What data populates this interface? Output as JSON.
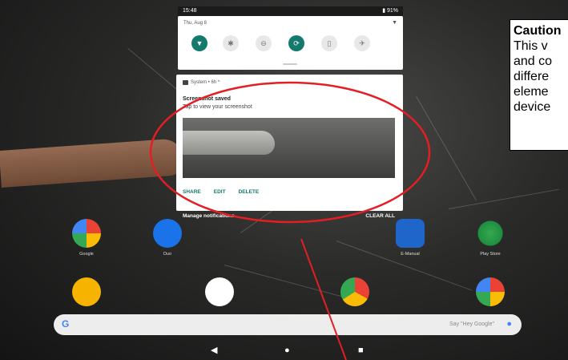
{
  "status_bar": {
    "time": "15:48",
    "battery": "91%"
  },
  "quick_settings": {
    "date": "Thu, Aug 8",
    "tiles": [
      {
        "name": "wifi-icon",
        "glyph": "▼",
        "on": true
      },
      {
        "name": "bluetooth-icon",
        "glyph": "✱",
        "on": false
      },
      {
        "name": "do-not-disturb-icon",
        "glyph": "⊖",
        "on": false
      },
      {
        "name": "auto-rotate-icon",
        "glyph": "⟳",
        "on": true
      },
      {
        "name": "flashlight-icon",
        "glyph": "▯",
        "on": false
      },
      {
        "name": "airplane-mode-icon",
        "glyph": "✈",
        "on": false
      }
    ]
  },
  "notification": {
    "app": "System • 6h ^",
    "title": "Screenshot saved",
    "subtitle": "Tap to view your screenshot",
    "actions": [
      "SHARE",
      "EDIT",
      "DELETE"
    ]
  },
  "shade_footer": {
    "manage": "Manage notifications",
    "clear_all": "CLEAR ALL"
  },
  "apps": [
    {
      "label": "Google"
    },
    {
      "label": "Duo"
    },
    {
      "label": "E-Manual"
    },
    {
      "label": "Play Store"
    }
  ],
  "search": {
    "logo": "G",
    "hint": "Say \"Hey Google\""
  },
  "nav": {
    "back": "◀",
    "home": "●",
    "recents": "■"
  },
  "caution": {
    "title": "Caution",
    "lines": [
      "This v",
      "and co",
      "differe",
      "eleme",
      "device"
    ]
  },
  "colors": {
    "accent": "#157a6e",
    "annotation": "#e31e24"
  }
}
